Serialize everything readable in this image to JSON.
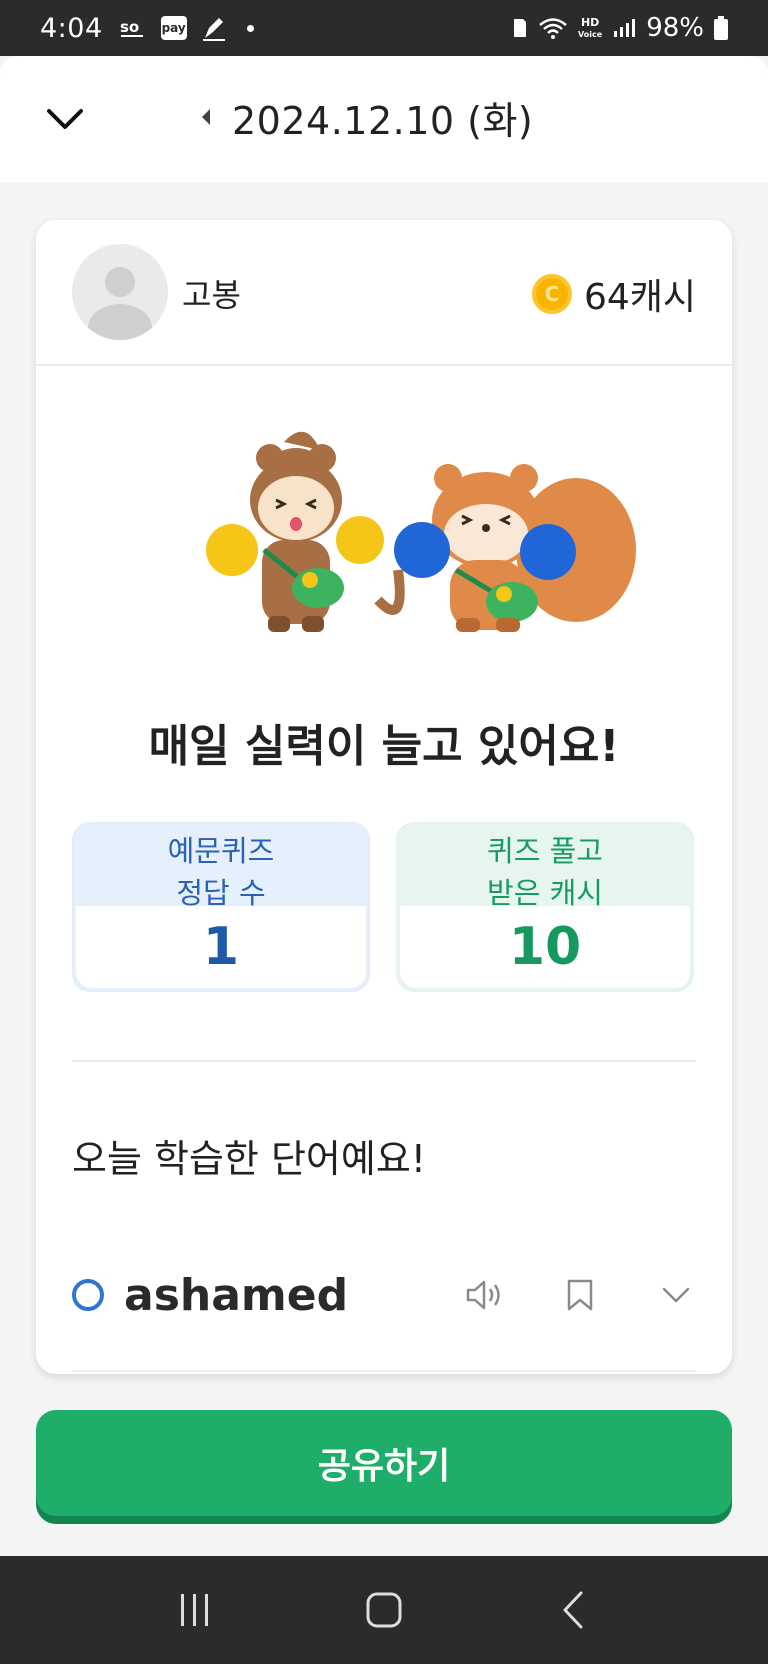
{
  "status_bar": {
    "time": "4:04",
    "app_icons": [
      "bank-sol-icon",
      "pay-icon",
      "pen-icon"
    ],
    "pay_label": "pay",
    "hd_label": "HD",
    "voice_label": "Voice",
    "battery": "98%"
  },
  "header": {
    "date": "2024.12.10 (화)"
  },
  "profile": {
    "username": "고봉",
    "cash": "64캐시"
  },
  "headline": "매일 실력이 늘고 있어요!",
  "stats": [
    {
      "label_line1": "예문퀴즈",
      "label_line2": "정답 수",
      "value": "1",
      "color": "#1f5aa8"
    },
    {
      "label_line1": "퀴즈 풀고",
      "label_line2": "받은 캐시",
      "value": "10",
      "color": "#17985f"
    }
  ],
  "learned": {
    "title": "오늘 학습한 단어예요!",
    "words": [
      {
        "word": "ashamed",
        "status": "circle"
      }
    ]
  },
  "share_button": {
    "label": "공유하기",
    "color": "#1fad6a"
  },
  "colors": {
    "accent_green": "#1fad6a",
    "accent_blue": "#2f74d0",
    "coin": "#f7b500"
  }
}
